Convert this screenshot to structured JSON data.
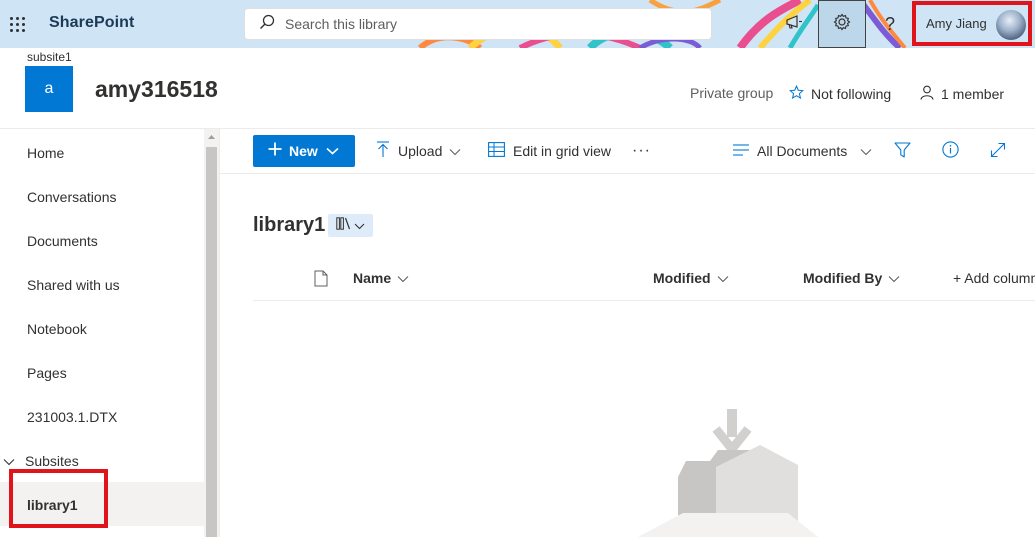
{
  "suitebar": {
    "app_name": "SharePoint",
    "search_placeholder": "Search this library",
    "user_name": "Amy Jiang"
  },
  "site": {
    "parent": "subsite1",
    "logo_letter": "a",
    "title": "amy316518",
    "privacy": "Private group",
    "follow": "Not following",
    "members": "1 member"
  },
  "nav": {
    "items": [
      "Home",
      "Conversations",
      "Documents",
      "Shared with us",
      "Notebook",
      "Pages",
      "231003.1.DTX"
    ],
    "group_label": "Subsites",
    "selected": "library1"
  },
  "commandbar": {
    "new": "New",
    "upload": "Upload",
    "edit_grid": "Edit in grid view",
    "more": "···",
    "view": "All Documents"
  },
  "library": {
    "title": "library1",
    "columns": {
      "name": "Name",
      "modified": "Modified",
      "modified_by": "Modified By",
      "add": "+ Add column"
    }
  },
  "colors": {
    "accent": "#0078d4",
    "highlight_box": "#e0151b",
    "selected_bg": "#f3f2f1",
    "suitebar_bg": "#cfe4f5"
  }
}
